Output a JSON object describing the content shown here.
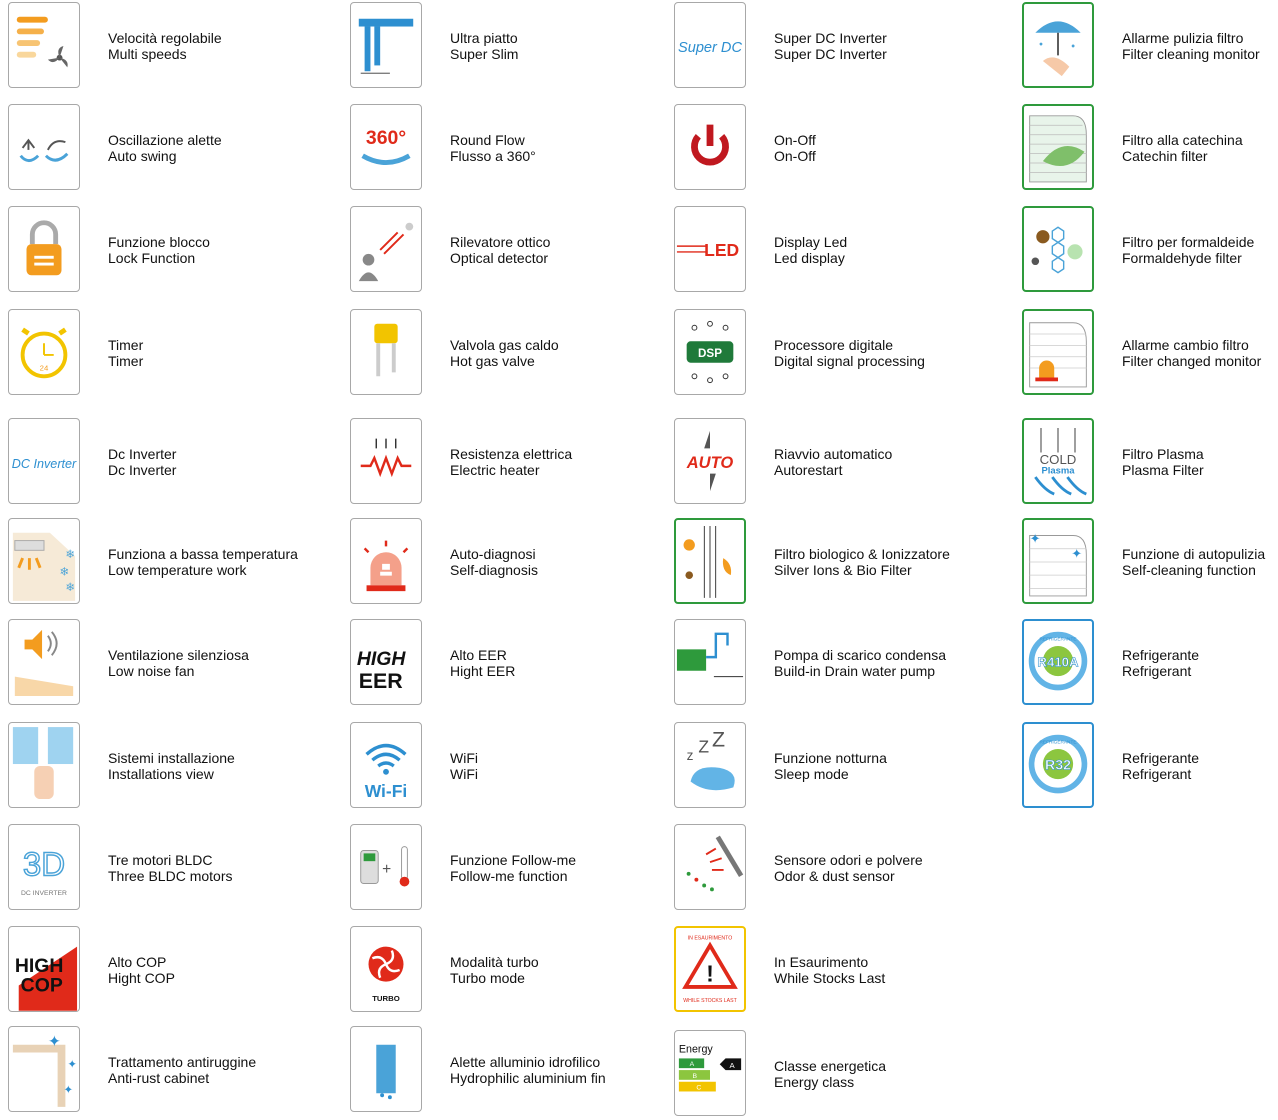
{
  "features": [
    {
      "it": "Velocità regolabile",
      "en": "Multi speeds",
      "icon": "multi-speeds-icon"
    },
    {
      "it": "Oscillazione alette",
      "en": "Auto swing",
      "icon": "auto-swing-icon"
    },
    {
      "it": "Funzione blocco",
      "en": "Lock Function",
      "icon": "lock-icon"
    },
    {
      "it": "Timer",
      "en": "Timer",
      "icon": "timer-icon",
      "label": "24"
    },
    {
      "it": "Dc Inverter",
      "en": "Dc Inverter",
      "icon": "dc-inverter-icon",
      "label": "DC Inverter"
    },
    {
      "it": "Funziona a bassa temperatura",
      "en": "Low temperature work",
      "icon": "low-temperature-icon"
    },
    {
      "it": "Ventilazione silenziosa",
      "en": "Low noise fan",
      "icon": "speaker-icon"
    },
    {
      "it": "Sistemi installazione",
      "en": "Installations view",
      "icon": "installation-icon"
    },
    {
      "it": "Tre motori BLDC",
      "en": "Three BLDC motors",
      "icon": "three-motors-icon",
      "label": "3D",
      "sublabel": "DC INVERTER"
    },
    {
      "it": "Alto COP",
      "en": "Hight COP",
      "icon": "high-cop-icon",
      "label": "HIGH",
      "sublabel": "COP"
    },
    {
      "it": "Trattamento antiruggine",
      "en": "Anti-rust cabinet",
      "icon": "anti-rust-icon"
    },
    {
      "it": "Ultra piatto",
      "en": "Super Slim",
      "icon": "caliper-icon"
    },
    {
      "it": "Round Flow",
      "en": "Flusso a 360°",
      "icon": "round-flow-icon",
      "label": "360°"
    },
    {
      "it": "Rilevatore ottico",
      "en": "Optical detector",
      "icon": "optical-detector-icon"
    },
    {
      "it": "Valvola gas caldo",
      "en": "Hot gas valve",
      "icon": "valve-icon"
    },
    {
      "it": "Resistenza elettrica",
      "en": "Electric heater",
      "icon": "heater-icon"
    },
    {
      "it": "Auto-diagnosi",
      "en": "Self-diagnosis",
      "icon": "self-diagnosis-icon"
    },
    {
      "it": "Alto EER",
      "en": "Hight EER",
      "icon": "high-eer-icon",
      "label": "HIGH",
      "sublabel": "EER"
    },
    {
      "it": "WiFi",
      "en": "WiFi",
      "icon": "wifi-icon",
      "label": "Wi-Fi"
    },
    {
      "it": "Funzione Follow-me",
      "en": "Follow-me function",
      "icon": "follow-me-icon"
    },
    {
      "it": "Modalità turbo",
      "en": "Turbo mode",
      "icon": "turbo-icon",
      "label": "TURBO"
    },
    {
      "it": "Alette alluminio idrofilico",
      "en": "Hydrophilic aluminium fin",
      "icon": "aluminium-fin-icon"
    },
    {
      "it": "Super DC Inverter",
      "en": "Super DC Inverter",
      "icon": "super-dc-icon",
      "label": "Super DC"
    },
    {
      "it": "On-Off",
      "en": "On-Off",
      "icon": "power-icon"
    },
    {
      "it": "Display Led",
      "en": "Led display",
      "icon": "led-display-icon",
      "label": "LED"
    },
    {
      "it": "Processore digitale",
      "en": "Digital signal processing",
      "icon": "dsp-icon",
      "label": "DSP"
    },
    {
      "it": "Riavvio automatico",
      "en": "Autorestart",
      "icon": "autorestart-icon",
      "label": "AUTO"
    },
    {
      "it": "Filtro biologico & Ionizzatore",
      "en": "Silver Ions & Bio Filter",
      "icon": "bio-filter-icon"
    },
    {
      "it": "Pompa di scarico condensa",
      "en": "Build-in Drain water pump",
      "icon": "drain-pump-icon"
    },
    {
      "it": "Funzione notturna",
      "en": "Sleep mode",
      "icon": "sleep-icon"
    },
    {
      "it": "Sensore odori e polvere",
      "en": "Odor & dust sensor",
      "icon": "odor-sensor-icon"
    },
    {
      "it": "In Esaurimento",
      "en": "While Stocks Last",
      "icon": "warning-icon",
      "label": "IN ESAURIMENTO",
      "sublabel": "WHILE STOCKS LAST"
    },
    {
      "it": "Classe energetica",
      "en": "Energy class",
      "icon": "energy-class-icon",
      "label": "Energy"
    },
    {
      "it": "Allarme pulizia filtro",
      "en": "Filter cleaning monitor",
      "icon": "filter-cleaning-icon"
    },
    {
      "it": "Filtro alla catechina",
      "en": "Catechin filter",
      "icon": "catechin-filter-icon"
    },
    {
      "it": "Filtro per formaldeide",
      "en": "Formaldehyde filter",
      "icon": "formaldehyde-filter-icon"
    },
    {
      "it": "Allarme cambio filtro",
      "en": "Filter changed monitor",
      "icon": "filter-changed-icon"
    },
    {
      "it": "Filtro Plasma",
      "en": "Plasma Filter",
      "icon": "plasma-filter-icon",
      "label": "COLD",
      "sublabel": "Plasma"
    },
    {
      "it": "Funzione di autopulizia",
      "en": "Self-cleaning function",
      "icon": "self-cleaning-icon"
    },
    {
      "it": "Refrigerante",
      "en": "Refrigerant",
      "icon": "r410a-icon",
      "label": "R410A",
      "sublabel": "REFRIGERANTE"
    },
    {
      "it": "Refrigerante",
      "en": "Refrigerant",
      "icon": "r32-icon",
      "label": "R32",
      "sublabel": "REFRIGERANTE"
    }
  ],
  "colors": {
    "orange": "#f39c1f",
    "blue": "#2d8fd0",
    "green": "#2e9a3c",
    "red": "#e02a1a",
    "yellow": "#f2c400"
  }
}
